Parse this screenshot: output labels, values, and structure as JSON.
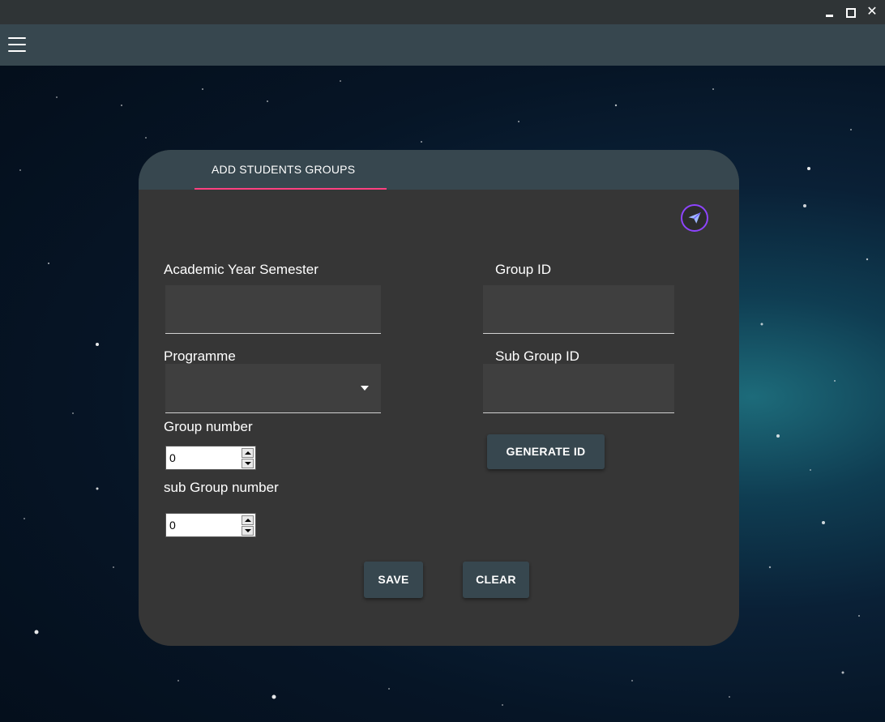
{
  "window": {
    "minimize_icon": "minimize-icon",
    "maximize_icon": "maximize-icon",
    "close_label": "✕"
  },
  "appbar": {
    "menu_icon": "hamburger-menu-icon",
    "background": "#37474f"
  },
  "card": {
    "tab_label": "ADD STUDENTS GROUPS",
    "tab_indicator_color": "#ff4081",
    "send_icon": "send-icon"
  },
  "form": {
    "academic_year_label": "Academic Year Semester",
    "academic_year_value": "",
    "programme_label": "Programme",
    "programme_value": "",
    "group_number_label": "Group number",
    "group_number_value": "0",
    "sub_group_number_label": "sub Group number",
    "sub_group_number_value": "0",
    "group_id_label": "Group ID",
    "group_id_value": "",
    "sub_group_id_label": "Sub Group ID",
    "sub_group_id_value": "",
    "generate_button": "GENERATE ID",
    "save_button": "SAVE",
    "clear_button": "CLEAR"
  }
}
